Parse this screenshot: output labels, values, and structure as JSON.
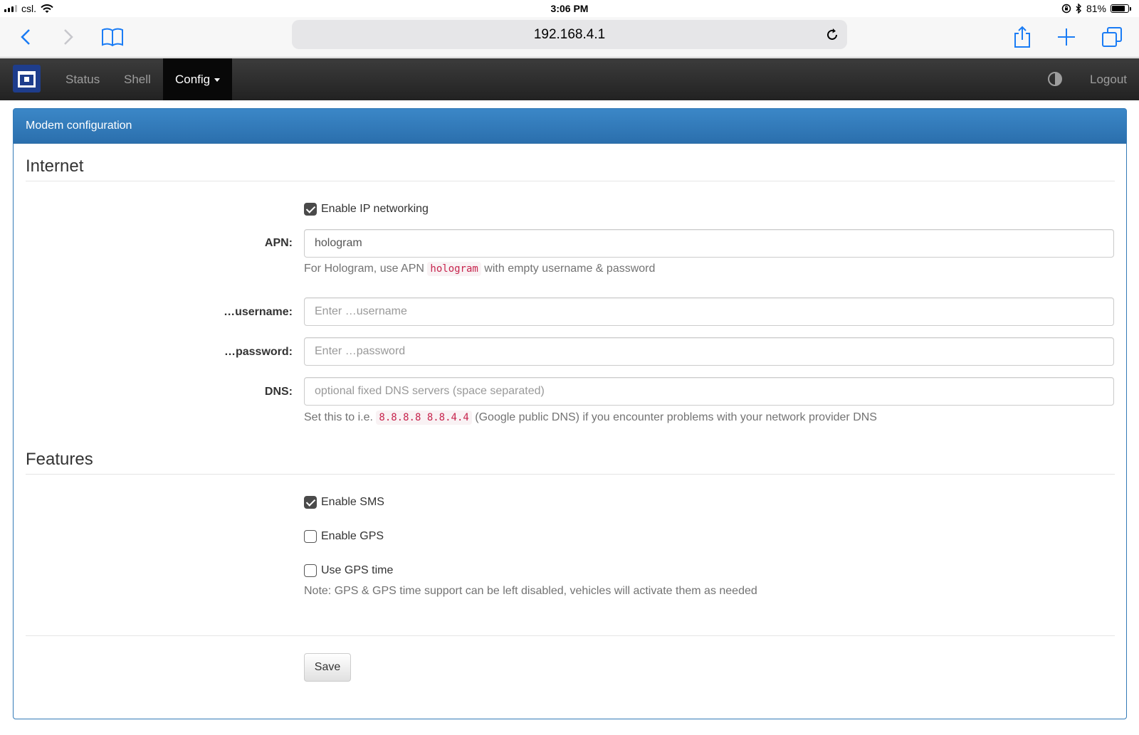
{
  "statusbar": {
    "carrier": "csl.",
    "time": "3:06 PM",
    "battery_percent": "81%",
    "battery_level": 0.81,
    "icons": [
      "signal-icon",
      "wifi-icon",
      "orientation-lock-icon",
      "bluetooth-icon",
      "battery-icon"
    ]
  },
  "browser": {
    "url": "192.168.4.1",
    "icons": [
      "back-icon",
      "forward-icon",
      "bookmarks-icon",
      "reload-icon",
      "share-icon",
      "new-tab-icon",
      "tabs-icon"
    ]
  },
  "navbar": {
    "items": [
      "Status",
      "Shell",
      "Config"
    ],
    "active": "Config",
    "logout": "Logout",
    "colors": {
      "background": "#222222",
      "active": "#080808",
      "brand": "#1e3d8c"
    }
  },
  "panel": {
    "title": "Modem configuration",
    "accent": "#337ab7"
  },
  "internet": {
    "legend": "Internet",
    "enable_ip": {
      "label": "Enable IP networking",
      "checked": true
    },
    "apn": {
      "label": "APN:",
      "value": "hologram"
    },
    "apn_help": {
      "before": "For Hologram, use APN",
      "code": "hologram",
      "after": "with empty username & password"
    },
    "username": {
      "label": "…username:",
      "placeholder": "Enter …username"
    },
    "password": {
      "label": "…password:",
      "placeholder": "Enter …password"
    },
    "dns": {
      "label": "DNS:",
      "placeholder": "optional fixed DNS servers (space separated)"
    },
    "dns_help": {
      "before": "Set this to i.e.",
      "code": "8.8.8.8 8.8.4.4",
      "after": "(Google public DNS) if you encounter problems with your network provider DNS"
    }
  },
  "features": {
    "legend": "Features",
    "sms": {
      "label": "Enable SMS",
      "checked": true
    },
    "gps": {
      "label": "Enable GPS",
      "checked": false
    },
    "gps_time": {
      "label": "Use GPS time",
      "checked": false
    },
    "note": "Note: GPS & GPS time support can be left disabled, vehicles will activate them as needed"
  },
  "actions": {
    "save": "Save"
  }
}
